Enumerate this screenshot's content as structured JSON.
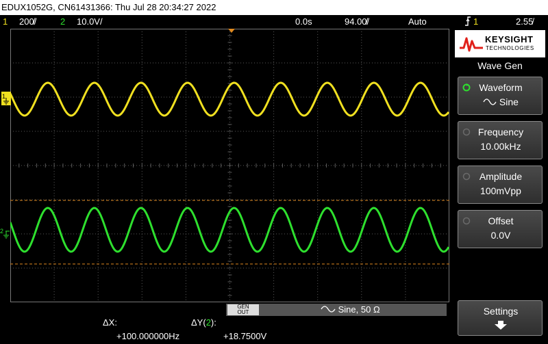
{
  "header": {
    "title": "EDUX1052G, CN61431366: Thu Jul 28 20:34:27 2022"
  },
  "status": {
    "ch1_num": "1",
    "ch1_scale": "200̸/",
    "ch2_num": "2",
    "ch2_scale": "10.0V/",
    "time_pos": "0.0s",
    "time_scale": "94.00̸/",
    "mode": "Auto",
    "trig_icon": "trigger-edge-icon",
    "trig_src": "1",
    "trig_level": "2.55̸"
  },
  "panel": {
    "brand": "KEYSIGHT",
    "brand_sub": "TECHNOLOGIES",
    "menu_title": "Wave Gen",
    "softkeys": [
      {
        "label": "Waveform",
        "value": "Sine"
      },
      {
        "label": "Frequency",
        "value": "10.00kHz"
      },
      {
        "label": "Amplitude",
        "value": "100mVpp"
      },
      {
        "label": "Offset",
        "value": "0.0V"
      },
      {
        "label": "Settings",
        "value": ""
      }
    ]
  },
  "bottom": {
    "gen_line1": "GEN",
    "gen_line2": "OUT",
    "wave_desc": "Sine, 50 Ω"
  },
  "measurements": {
    "dx_label": "ΔX:",
    "dx_value": "+100.000000Hz",
    "dy_label_a": "ΔY(",
    "dy_label_ch": "2",
    "dy_label_b": "):",
    "dy_value": "+18.7500V"
  },
  "colors": {
    "ch1": "#f0e020",
    "ch2": "#2ee02e",
    "cursor": "#e08a20",
    "grid": "#5a5a5a"
  }
}
